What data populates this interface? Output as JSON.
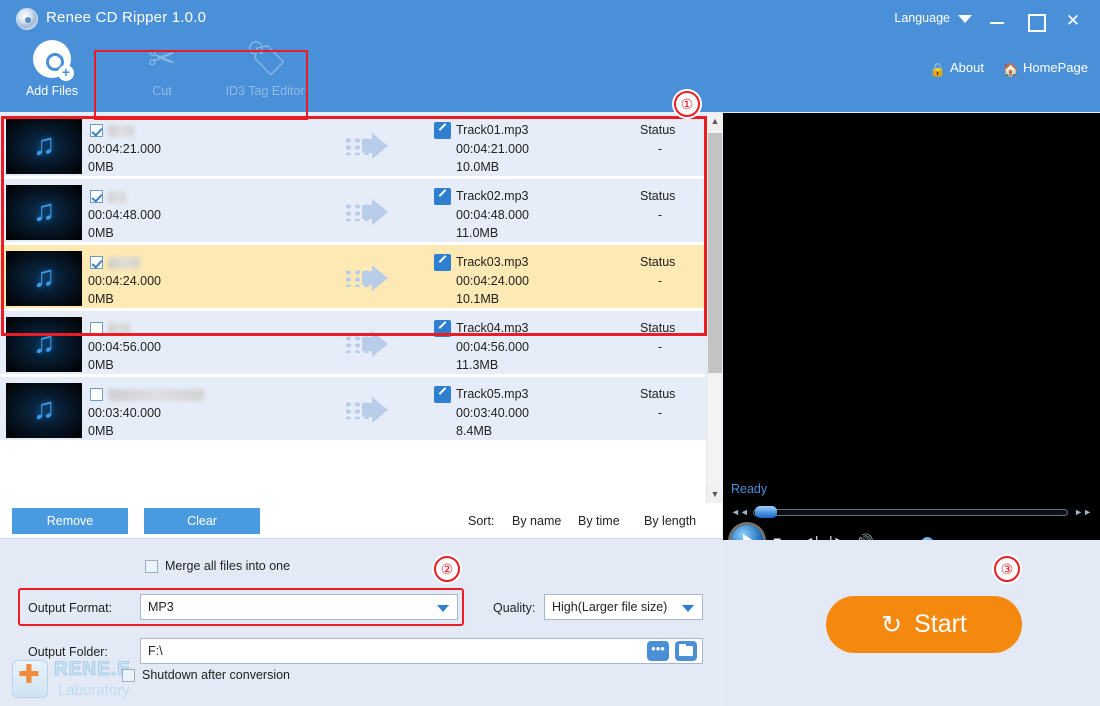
{
  "window": {
    "title": "Renee CD Ripper 1.0.0",
    "logo_icon": "cd-disc-icon",
    "language_label": "Language",
    "minimize_label": "",
    "maximize_label": "",
    "close_label": "✕"
  },
  "toolbar": {
    "items": [
      {
        "label": "Add Files",
        "icon": "add-disc-icon",
        "enabled": true
      },
      {
        "label": "Cut",
        "icon": "scissors-icon",
        "enabled": false
      },
      {
        "label": "ID3 Tag Editor",
        "icon": "tag-icon",
        "enabled": false
      }
    ],
    "about_label": "About",
    "about_icon": "lock-icon",
    "home_label": "HomePage",
    "home_icon": "home-icon"
  },
  "annotations": {
    "one": "①",
    "two": "②",
    "three": "③"
  },
  "file_list": {
    "columns": {
      "status": "Status",
      "status_value": "-"
    },
    "rows": [
      {
        "checked": true,
        "selected": false,
        "src_time": "00:04:21.000",
        "src_size": "0MB",
        "out_name": "Track01.mp3",
        "out_time": "00:04:21.000",
        "out_size": "10.0MB",
        "status": "Status",
        "status_value": "-",
        "redact_w": 26
      },
      {
        "checked": true,
        "selected": false,
        "src_time": "00:04:48.000",
        "src_size": "0MB",
        "out_name": "Track02.mp3",
        "out_time": "00:04:48.000",
        "out_size": "11.0MB",
        "status": "Status",
        "status_value": "-",
        "redact_w": 18
      },
      {
        "checked": true,
        "selected": true,
        "src_time": "00:04:24.000",
        "src_size": "0MB",
        "out_name": "Track03.mp3",
        "out_time": "00:04:24.000",
        "out_size": "10.1MB",
        "status": "Status",
        "status_value": "-",
        "redact_w": 32
      },
      {
        "checked": false,
        "selected": false,
        "src_time": "00:04:56.000",
        "src_size": "0MB",
        "out_name": "Track04.mp3",
        "out_time": "00:04:56.000",
        "out_size": "11.3MB",
        "status": "Status",
        "status_value": "-",
        "redact_w": 22
      },
      {
        "checked": false,
        "selected": false,
        "src_time": "00:03:40.000",
        "src_size": "0MB",
        "out_name": "Track05.mp3",
        "out_time": "00:03:40.000",
        "out_size": "8.4MB",
        "status": "Status",
        "status_value": "-",
        "redact_w": 96
      }
    ]
  },
  "list_toolbar": {
    "remove_label": "Remove",
    "clear_label": "Clear",
    "sort_label": "Sort:",
    "sort_options": [
      "By name",
      "By time",
      "By length"
    ]
  },
  "settings": {
    "merge_label": "Merge all files into one",
    "merge_checked": false,
    "output_format_label": "Output Format:",
    "output_format_value": "MP3",
    "quality_label": "Quality:",
    "quality_value": "High(Larger file size)",
    "output_folder_label": "Output Folder:",
    "output_folder_value": "F:\\",
    "browse_icon": "ellipsis-icon",
    "open_folder_icon": "folder-icon"
  },
  "watermark": {
    "line1": "RENE.E",
    "line2": "Laboratory",
    "icon": "red-cross-icon"
  },
  "preview": {
    "status_text": "Ready",
    "rewind_icon": "rewind-icon",
    "forward_icon": "fast-forward-icon",
    "play_icon": "play-icon",
    "stop_icon": "■",
    "prev_icon": "◄|",
    "next_icon": "|►",
    "volume_icon": "🔊"
  },
  "start_panel": {
    "start_label": "Start",
    "start_icon": "refresh-icon",
    "shutdown_label": "Shutdown after conversion",
    "shutdown_checked": false,
    "accent_color": "#f5880f"
  },
  "colors": {
    "header_blue": "#4a90d9",
    "row_blue": "#e7edf8",
    "row_selected": "#fde9b4",
    "highlight_red": "#ec1c24",
    "panel_bg": "#e3eaf6"
  }
}
